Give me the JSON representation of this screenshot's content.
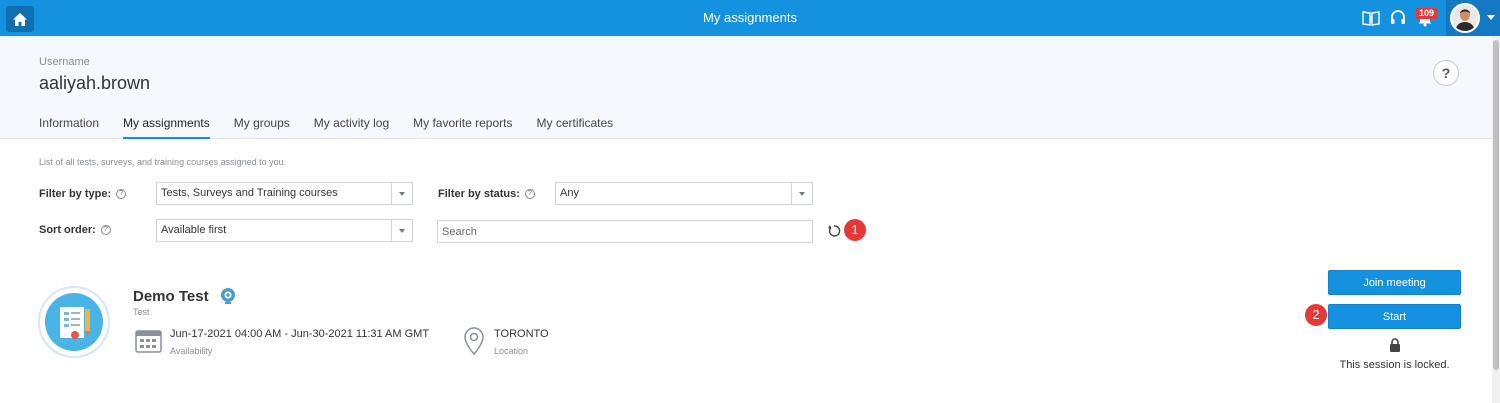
{
  "topbar": {
    "title": "My assignments",
    "notification_count": "109",
    "colors": {
      "bar": "#1592df",
      "badge": "#e53935"
    },
    "icons": [
      "home-icon",
      "help-book-icon",
      "headset-icon",
      "notification-bell-icon",
      "user-avatar"
    ]
  },
  "header": {
    "username_label": "Username",
    "username": "aaliyah.brown",
    "help_label": "?"
  },
  "tabs": [
    {
      "label": "Information",
      "active": false
    },
    {
      "label": "My assignments",
      "active": true
    },
    {
      "label": "My groups",
      "active": false
    },
    {
      "label": "My activity log",
      "active": false
    },
    {
      "label": "My favorite reports",
      "active": false
    },
    {
      "label": "My certificates",
      "active": false
    }
  ],
  "filters": {
    "description": "List of all tests, surveys, and training courses assigned to you.",
    "type_label": "Filter by type:",
    "type_value": "Tests, Surveys and Training courses",
    "status_label": "Filter by status:",
    "status_value": "Any",
    "sort_label": "Sort order:",
    "sort_value": "Available first",
    "search_placeholder": "Search",
    "step1": "1"
  },
  "item": {
    "title": "Demo Test",
    "type": "Test",
    "availability_value": "Jun-17-2021 04:00 AM - Jun-30-2021 11:31 AM GMT",
    "availability_label": "Availability",
    "location_value": "TORONTO",
    "location_label": "Location",
    "join_button": "Join meeting",
    "start_button": "Start",
    "step2": "2",
    "locked_text": "This session is locked."
  }
}
